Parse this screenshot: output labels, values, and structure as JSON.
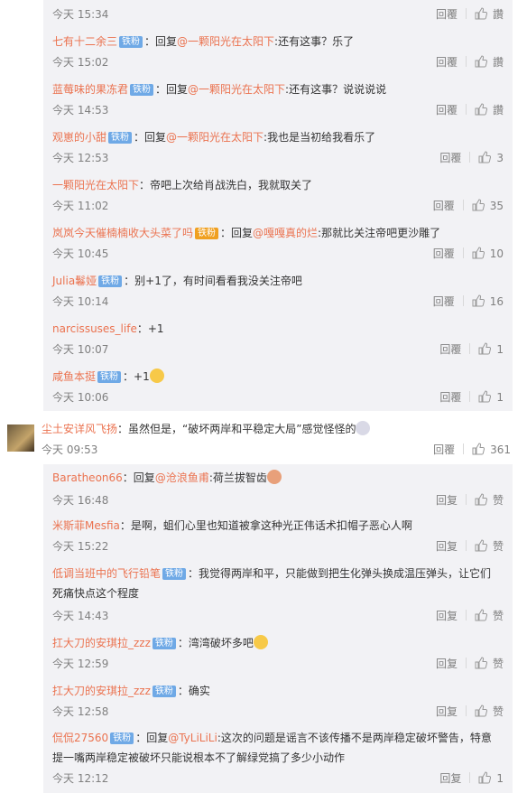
{
  "labels": {
    "reply": "回复",
    "like": "赞"
  },
  "top_replies": [
    {
      "time": "今天 15:34",
      "reply_label": "回覆",
      "like_label": "讚"
    },
    {
      "user": "七有十二余三",
      "badge": "铁粉",
      "prefix": "：回复",
      "mention": "@一颗阳光在太阳下",
      "text": ":还有这事？乐了",
      "time": "今天 15:02",
      "reply_label": "回覆",
      "like_label": "讚"
    },
    {
      "user": "蓝莓味的果冻君",
      "badge": "铁粉",
      "prefix": "：回复",
      "mention": "@一颗阳光在太阳下",
      "text": ":还有这事？说说说说",
      "time": "今天 14:53",
      "reply_label": "回覆",
      "like_label": "讚"
    },
    {
      "user": "观崽的小甜",
      "badge": "铁粉",
      "prefix": "：回复",
      "mention": "@一颗阳光在太阳下",
      "text": ":我也是当初给我看乐了",
      "time": "今天 12:53",
      "reply_label": "回覆",
      "like_label": "3"
    },
    {
      "user": "一颗阳光在太阳下",
      "text": "：帝吧上次给肖战洗白，我就取关了",
      "time": "今天 11:02",
      "reply_label": "回覆",
      "like_label": "35"
    },
    {
      "user": "岚岚今天催楠楠收大头菜了吗",
      "badge": "铁粉",
      "prefix": "：回复",
      "mention": "@嘎嘎真的烂",
      "text": ":那就比关注帝吧更沙雕了",
      "time": "今天 10:45",
      "reply_label": "回覆",
      "like_label": "10"
    },
    {
      "user": "Julia鬈娅",
      "badge": "铁粉",
      "text": "：别+1了，有时间看看我没关注帝吧",
      "time": "今天 10:14",
      "reply_label": "回覆",
      "like_label": "16"
    },
    {
      "user": "narcissuses_life",
      "text": "：+1",
      "time": "今天 10:07",
      "reply_label": "回覆",
      "like_label": "1"
    },
    {
      "user": "咸鱼本挺",
      "badge": "铁粉",
      "text": "：+1",
      "time": "今天 10:06",
      "reply_label": "回覆",
      "like_label": "1"
    }
  ],
  "main_comment": {
    "user": "尘土安详风飞扬",
    "text": "：虽然但是，“破坏两岸和平稳定大局”感觉怪怪的",
    "time": "今天 09:53",
    "reply_label": "回覆",
    "like_label": "361"
  },
  "bottom_replies": [
    {
      "user": "Baratheon66",
      "prefix": "：回复",
      "mention": "@沧浪鱼甫",
      "text": ":荷兰拔智齿",
      "time": "今天 16:48",
      "reply_label": "回复",
      "like_label": "赞"
    },
    {
      "user": "米斯菲Mesfia",
      "text": "：是啊，蛆们心里也知道被拿这种光正伟话术扣帽子恶心人啊",
      "time": "今天 15:22",
      "reply_label": "回复",
      "like_label": "赞"
    },
    {
      "user": "低调当班中的飞行铅笔",
      "badge": "铁粉",
      "text": "：我觉得两岸和平，只能做到把生化弹头换成温压弹头，让它们死痛快点这个程度",
      "time": "今天 14:43",
      "reply_label": "回复",
      "like_label": "赞"
    },
    {
      "user": "扛大刀的安琪拉_zzz",
      "badge": "铁粉",
      "text": "：湾湾破坏多吧",
      "time": "今天 12:59",
      "reply_label": "回复",
      "like_label": "赞"
    },
    {
      "user": "扛大刀的安琪拉_zzz",
      "badge": "铁粉",
      "text": "：确实",
      "time": "今天 12:58",
      "reply_label": "回复",
      "like_label": "赞"
    },
    {
      "user": "侃侃27560",
      "badge": "铁粉",
      "prefix": "：回复",
      "mention": "@TyLiLiLi",
      "text": ":这次的问题是谣言不该传播不是两岸稳定破坏警告，特意提一嘴两岸稳定被破坏只能说根本不了解绿党搞了多少小动作",
      "time": "今天 12:12",
      "reply_label": "回复",
      "like_label": "1"
    }
  ]
}
